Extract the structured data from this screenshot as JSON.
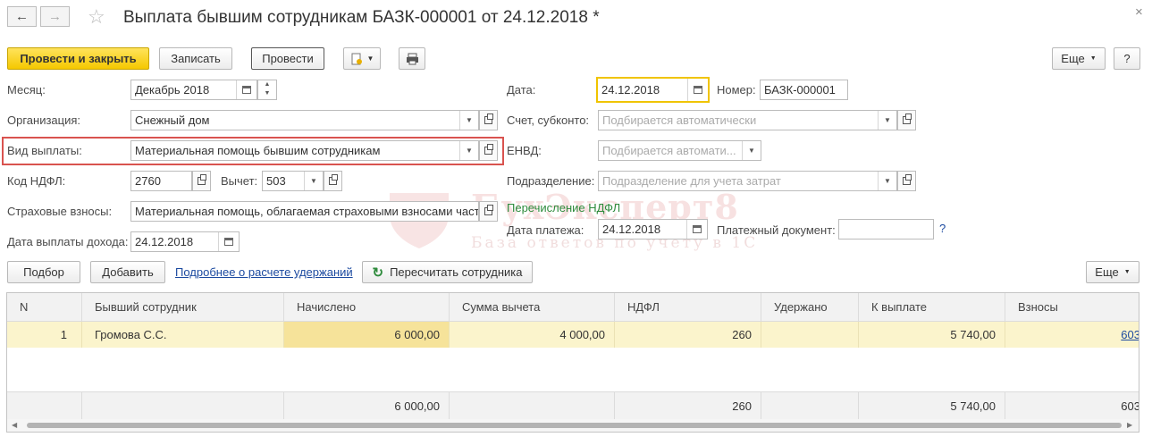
{
  "window": {
    "title": "Выплата бывшим сотрудникам БАЗК-000001 от 24.12.2018 *",
    "close_glyph": "×"
  },
  "toolbar": {
    "post_close": "Провести и закрыть",
    "save": "Записать",
    "post": "Провести",
    "more": "Еще",
    "help": "?"
  },
  "form": {
    "month": {
      "label": "Месяц:",
      "value": "Декабрь 2018"
    },
    "organization": {
      "label": "Организация:",
      "value": "Снежный дом"
    },
    "payment_type": {
      "label": "Вид выплаты:",
      "value": "Материальная помощь бывшим сотрудникам"
    },
    "ndfl_code": {
      "label": "Код НДФЛ:",
      "value": "2760"
    },
    "deduction": {
      "label": "Вычет:",
      "value": "503"
    },
    "insurance": {
      "label": "Страховые взносы:",
      "value": "Материальная помощь, облагаемая страховыми взносами част"
    },
    "income_date": {
      "label": "Дата выплаты дохода:",
      "value": "24.12.2018"
    },
    "date": {
      "label": "Дата:",
      "value": "24.12.2018"
    },
    "number": {
      "label": "Номер:",
      "value": "БАЗК-000001"
    },
    "account": {
      "label": "Счет, субконто:",
      "placeholder": "Подбирается автоматически"
    },
    "envd": {
      "label": "ЕНВД:",
      "placeholder": "Подбирается автомати..."
    },
    "department": {
      "label": "Подразделение:",
      "placeholder": "Подразделение для учета затрат"
    },
    "ndfl_transfer": "Перечисление НДФЛ",
    "payment_date": {
      "label": "Дата платежа:",
      "value": "24.12.2018"
    },
    "payment_doc": {
      "label": "Платежный документ:",
      "value": "",
      "help": "?"
    }
  },
  "watermark": {
    "brand": "БухЭксперт8",
    "tagline": "База ответов по учету в 1С"
  },
  "table_toolbar": {
    "select": "Подбор",
    "add": "Добавить",
    "details_link": "Подробнее о расчете удержаний",
    "recalc": "Пересчитать сотрудника",
    "more": "Еще"
  },
  "table": {
    "columns": [
      "N",
      "Бывший сотрудник",
      "Начислено",
      "Сумма вычета",
      "НДФЛ",
      "Удержано",
      "К выплате",
      "Взносы"
    ],
    "rows": [
      {
        "n": "1",
        "employee": "Громова С.С.",
        "accrued": "6 000,00",
        "deduction": "4 000,00",
        "ndfl": "260",
        "withheld": "",
        "to_pay": "5 740,00",
        "contrib": "603"
      }
    ],
    "totals": {
      "accrued": "6 000,00",
      "ndfl": "260",
      "to_pay": "5 740,00",
      "contrib": "603"
    }
  },
  "colors": {
    "accent_yellow": "#f5c800",
    "highlight_red": "#d9534f",
    "row_selected": "#fbf4cc",
    "green_text": "#2e8b3c",
    "link_blue": "#1c4aa0"
  }
}
